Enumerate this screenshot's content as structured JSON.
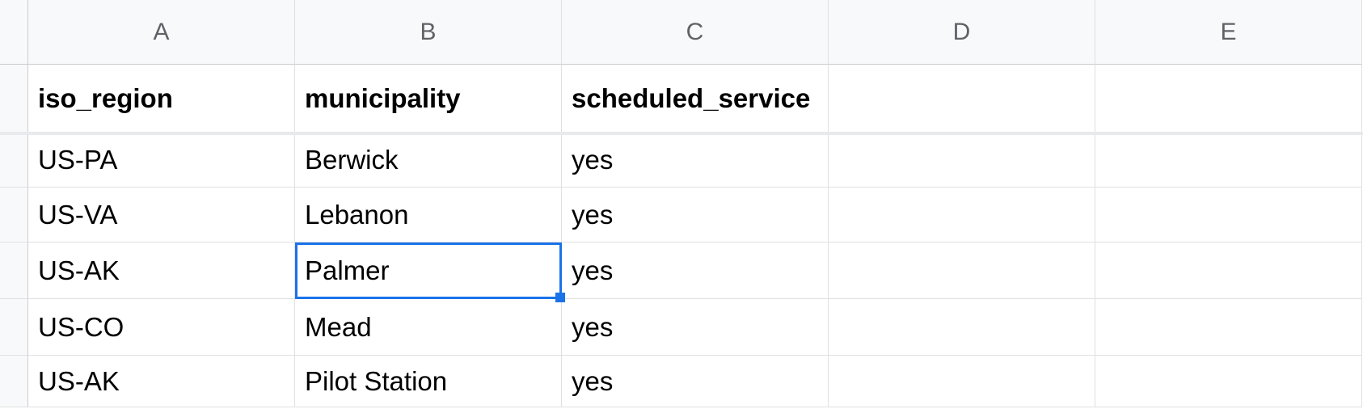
{
  "columns": [
    "A",
    "B",
    "C",
    "D",
    "E"
  ],
  "headers": {
    "A": "iso_region",
    "B": "municipality",
    "C": "scheduled_service",
    "D": "",
    "E": ""
  },
  "rows": [
    {
      "A": "US-PA",
      "B": "Berwick",
      "C": "yes",
      "D": "",
      "E": ""
    },
    {
      "A": "US-VA",
      "B": "Lebanon",
      "C": "yes",
      "D": "",
      "E": ""
    },
    {
      "A": "US-AK",
      "B": "Palmer",
      "C": "yes",
      "D": "",
      "E": ""
    },
    {
      "A": "US-CO",
      "B": "Mead",
      "C": "yes",
      "D": "",
      "E": ""
    },
    {
      "A": "US-AK",
      "B": "Pilot Station",
      "C": "yes",
      "D": "",
      "E": ""
    }
  ],
  "selected": {
    "col": "B",
    "row": 2
  }
}
